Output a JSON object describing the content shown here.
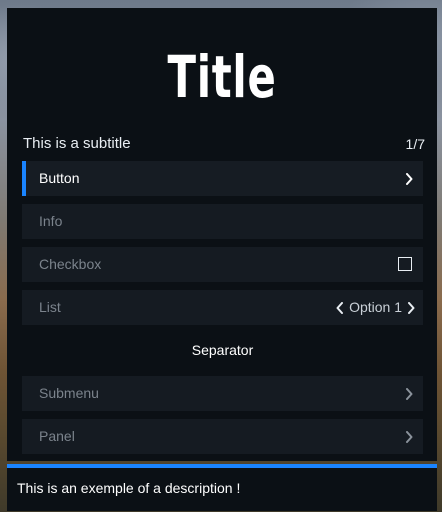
{
  "menu": {
    "title": "Title",
    "subtitle": "This is a subtitle",
    "counter": "1/7",
    "items": [
      {
        "label": "Button",
        "type": "button",
        "active": true
      },
      {
        "label": "Info",
        "type": "info"
      },
      {
        "label": "Checkbox",
        "type": "checkbox",
        "checked": false
      },
      {
        "label": "List",
        "type": "list",
        "value": "Option 1"
      },
      {
        "label": "Separator",
        "type": "separator"
      },
      {
        "label": "Submenu",
        "type": "submenu"
      },
      {
        "label": "Panel",
        "type": "panel"
      }
    ],
    "description": "This is an exemple of a description !"
  },
  "colors": {
    "accent": "#1a84ff",
    "menu_background": "#0b1015",
    "item_background": "#151b22",
    "text_primary": "#ffffff",
    "text_muted": "#7b838c"
  },
  "icons": {
    "chevron": "chevron-right-icon",
    "list_prev": "chevron-left-icon",
    "list_next": "chevron-right-icon",
    "checkbox": "checkbox-icon"
  }
}
